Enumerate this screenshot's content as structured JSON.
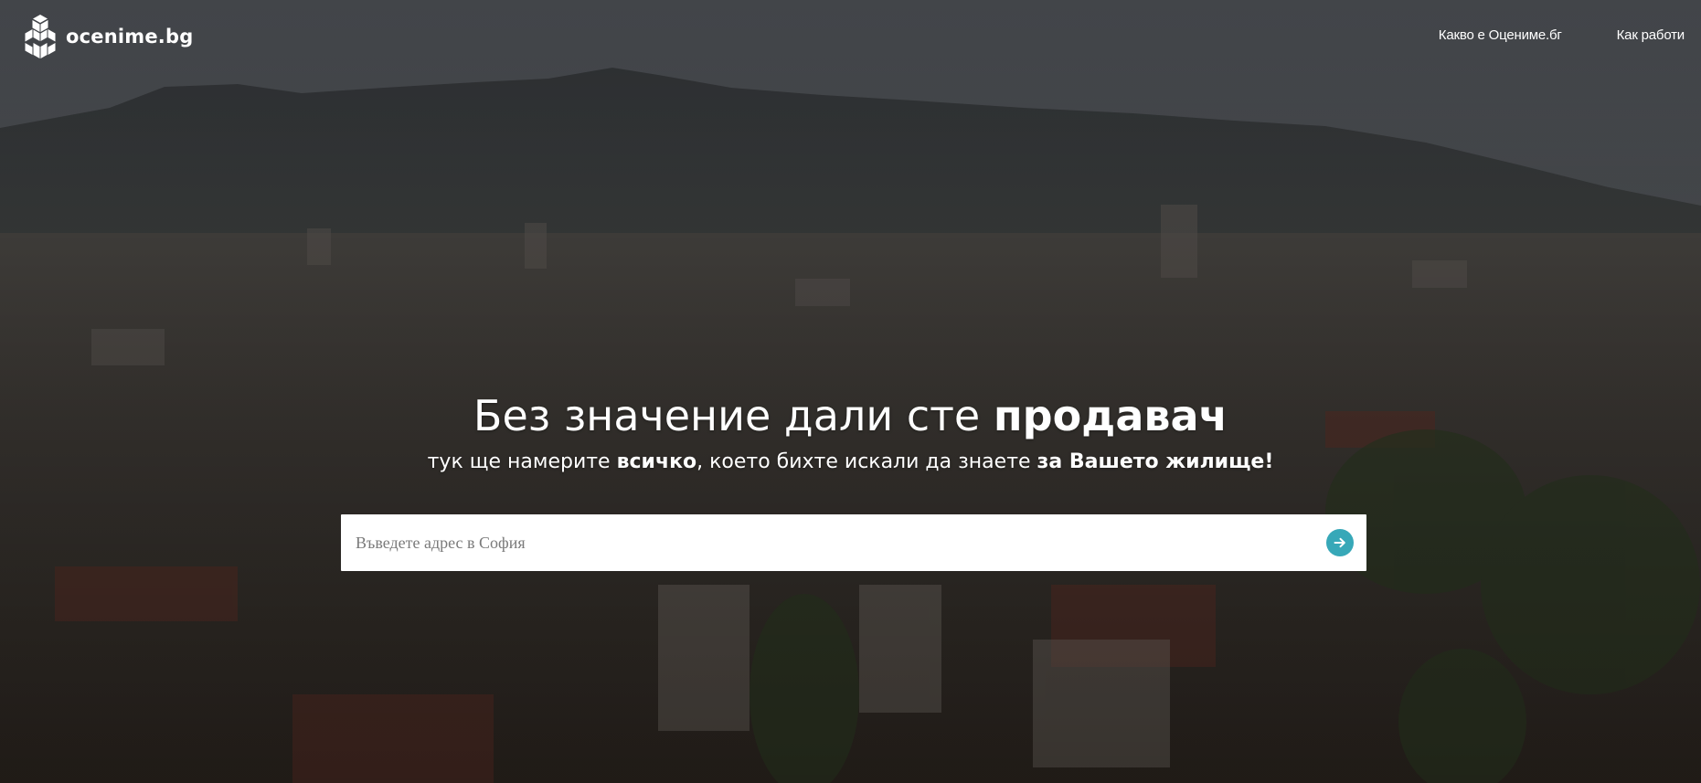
{
  "brand": {
    "name": "ocenime.bg",
    "logo_icon": "stacked-cubes-icon"
  },
  "nav": {
    "items": [
      {
        "label": "Какво е Оцениме.бг"
      },
      {
        "label": "Как работи"
      }
    ]
  },
  "hero": {
    "headline": {
      "part1": "Без значение дали сте ",
      "bold1": "продавач"
    },
    "subline": {
      "part1": "тук ще намерите ",
      "bold1": "всичко",
      "part2": ", което бихте искали да знаете ",
      "bold2": "за Вашето жилище!"
    },
    "background": "aerial-city-skyline-with-mountain-photo"
  },
  "search": {
    "placeholder": "Въведете адрес в София",
    "value": "",
    "submit_icon": "arrow-right-circle-icon"
  },
  "colors": {
    "accent": "#37a8b8",
    "text_on_hero": "#ffffff",
    "search_bg": "#ffffff"
  }
}
